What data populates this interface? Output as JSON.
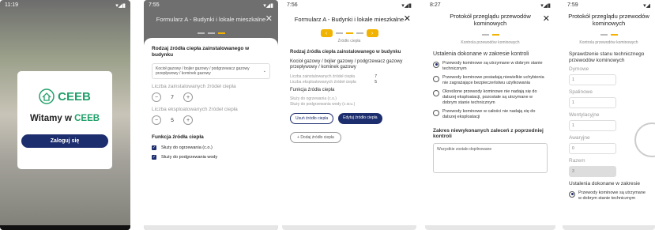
{
  "phone1": {
    "time": "11:19",
    "app_name": "CEEB",
    "welcome_prefix": "Witamy w",
    "welcome_brand": "CEEB",
    "login_label": "Zaloguj się"
  },
  "phone2": {
    "time": "7:55",
    "title": "Formularz A - Budynki i lokale mieszkalne",
    "section_title": "Rodzaj źródła ciepła zainstalowanego w budynku",
    "select_value": "Kocioł gazowy / bojler gazowy / podgrzewacz gazowy przepływowy / kominek gazowy",
    "installed_label": "Liczba zainstalowanych źródeł ciepła",
    "installed_count": "7",
    "used_label": "Liczba eksploatowanych źródeł ciepła",
    "used_count": "5",
    "function_title": "Funkcja źródła ciepła",
    "check1": "Służy do ogrzewania (c.o.)",
    "check2": "Służy do podgrzewania wody"
  },
  "phone3": {
    "time": "7:56",
    "title": "Formularz A - Budynki i lokale mieszkalne",
    "step_caption": "Źródło ciepła",
    "section_title": "Rodzaj źródła ciepła zainstalowanego w budynku",
    "value": "Kocioł gazowy / bojler gazowy / podgrzewacz gazowy przepływowy / kominek gazowy",
    "installed_label": "Liczba zainstalowanych źródeł ciepła",
    "installed_count": "7",
    "used_label": "Liczba eksploatowanych źródeł ciepła",
    "used_count": "5",
    "function_title": "Funkcja źródła ciepła",
    "function_1": "Służy do ogrzewania (c.o.)",
    "function_2": "Służy do podgrzewania wody (c.w.u.)",
    "delete_label": "Usuń źródło ciepła",
    "edit_label": "Edytuj źródło ciepła",
    "add_label": "Dodaj źródło ciepła"
  },
  "phone4": {
    "time": "8:27",
    "title": "Protokół przeglądu przewodów kominowych",
    "step_caption": "Kontrola przewodów kominowych",
    "section_title": "Ustalenia dokonane w zakresie kontroli",
    "options": [
      "Przewody kominowe są utrzymane w dobrym stanie technicznym",
      "Przewody kominowe posiadają niewielkie uchybienia nie zagrażające bezpieczeństwu użytkowania",
      "Określone przewody kominowe nie nadają się do dalszej eksploatacji, pozostałe są utrzymane w dobrym stanie technicznym",
      "Przewody kominowe w całości nie nadają się do dalszej eksploatacji"
    ],
    "recommend_title": "Zakres niewykonanych zaleceń z poprzedniej kontroli",
    "recommend_value": "Wszystkie zostało dopilnowane"
  },
  "phone5": {
    "time": "7:59",
    "title": "Protokół przeglądu przewodów kominowych",
    "step_caption": "Kontrola przewodów kominowych",
    "section_title": "Sprawdzenie stanu technicznego przewodów kominowych",
    "fields": [
      {
        "label": "Dymowe",
        "value": "1"
      },
      {
        "label": "Spalinowe",
        "value": "1"
      },
      {
        "label": "Wentylacyjne",
        "value": "1"
      },
      {
        "label": "Awaryjne",
        "value": "0"
      },
      {
        "label": "Razem",
        "value": "3"
      }
    ],
    "bottom_title": "Ustalenia dokonane w zakresie",
    "bottom_option": "Przewody kominowe są utrzymane w dobrym stanie technicznym"
  }
}
